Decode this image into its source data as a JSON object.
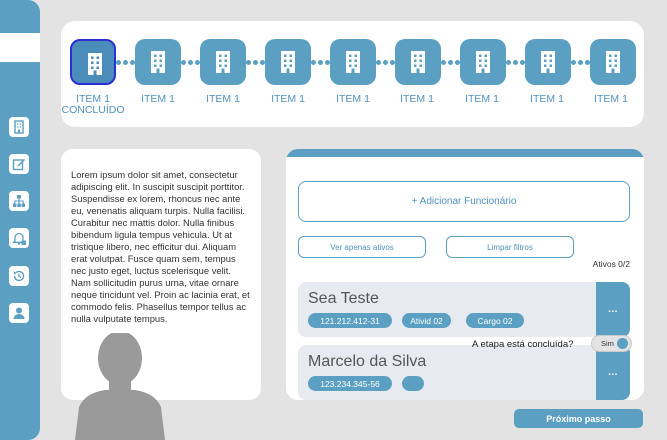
{
  "stepper": {
    "steps": [
      {
        "label": "ITEM 1",
        "sublabel": "CONCLUÍDO",
        "icon": "building-icon"
      },
      {
        "label": "ITEM 1",
        "icon": "building-icon"
      },
      {
        "label": "ITEM 1",
        "icon": "building-icon"
      },
      {
        "label": "ITEM 1",
        "icon": "building-icon"
      },
      {
        "label": "ITEM 1",
        "icon": "building-icon"
      },
      {
        "label": "ITEM 1",
        "icon": "building-icon"
      },
      {
        "label": "ITEM 1",
        "icon": "building-icon"
      },
      {
        "label": "ITEM 1",
        "icon": "building-icon"
      },
      {
        "label": "ITEM 1",
        "icon": "building-icon"
      }
    ]
  },
  "sidebar": {
    "icons": [
      "building-icon",
      "edit-icon",
      "org-chart-icon",
      "bell-icon",
      "history-icon",
      "user-icon"
    ]
  },
  "info": {
    "text": "Lorem ipsum dolor sit amet, consectetur adipiscing elit. In suscipit suscipit porttitor. Suspendisse ex lorem, rhoncus nec ante eu, venenatis aliquam turpis. Nulla facilisi. Curabitur nec mattis dolor. Nulla finibus bibendum ligula tempus vehicula. Ut at tristique libero, nec efficitur dui. Aliquam erat volutpat. Fusce quam sem, tempus nec justo eget, luctus scelerisque velit. Nam sollicitudin purus urna, vitae ornare neque tincidunt vel. Proin ac lacinia erat, et commodo felis. Phasellus tempor tellus ac nulla vulputate tempus."
  },
  "employees": {
    "add_label": "+ Adicionar Funcionário",
    "filter_active_label": "Ver apenas ativos",
    "clear_filters_label": "Limpar filtros",
    "active_count": "Ativos 0/2",
    "menu_label": "...",
    "list": [
      {
        "name": "Sea Teste",
        "tags": [
          "121.212.412-31",
          "Ativid 02",
          "Cargo 02"
        ]
      },
      {
        "name": "Marcelo da Silva",
        "tags": [
          "123.234.345-56",
          ""
        ]
      }
    ]
  },
  "completion": {
    "question": "A etapa está concluída?",
    "toggle_label": "Sim"
  },
  "next_label": "Próximo passo",
  "colors": {
    "accent": "#5b9fc2",
    "active_border": "#2a2fd6",
    "background": "#e3e3e3",
    "card": "#ffffff",
    "row_bg": "#e7ebf1"
  }
}
